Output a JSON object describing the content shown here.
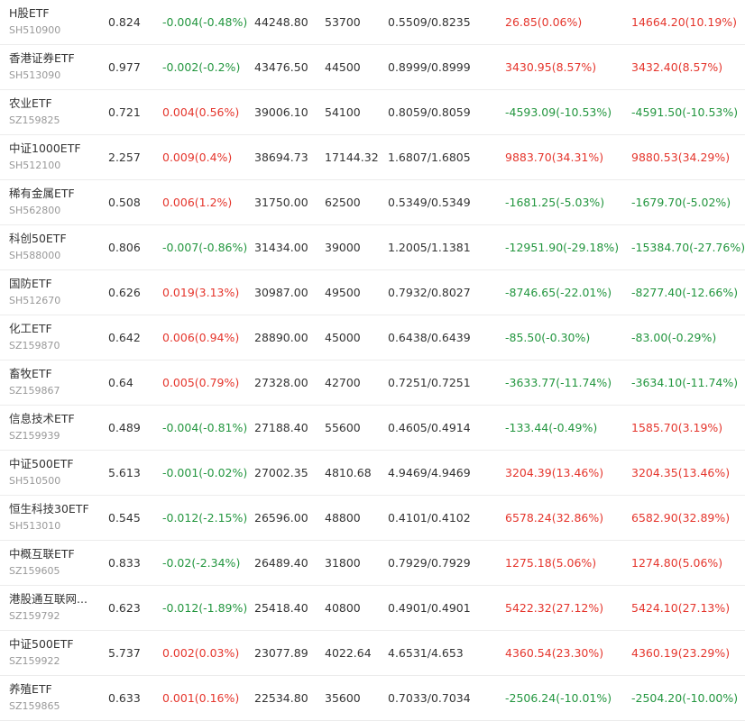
{
  "colors": {
    "up": "#e5362d",
    "down": "#23963f",
    "text": "#333333",
    "muted": "#999999"
  },
  "rows": [
    {
      "name": "H股ETF",
      "code": "SH510900",
      "price": "0.824",
      "change": "-0.004(-0.48%)",
      "change_dir": "down",
      "amount": "44248.80",
      "volume": "53700",
      "range": "0.5509/0.8235",
      "pnl1": "26.85(0.06%)",
      "pnl1_dir": "up",
      "pnl2": "14664.20(10.19%)",
      "pnl2_dir": "up"
    },
    {
      "name": "香港证券ETF",
      "code": "SH513090",
      "price": "0.977",
      "change": "-0.002(-0.2%)",
      "change_dir": "down",
      "amount": "43476.50",
      "volume": "44500",
      "range": "0.8999/0.8999",
      "pnl1": "3430.95(8.57%)",
      "pnl1_dir": "up",
      "pnl2": "3432.40(8.57%)",
      "pnl2_dir": "up"
    },
    {
      "name": "农业ETF",
      "code": "SZ159825",
      "price": "0.721",
      "change": "0.004(0.56%)",
      "change_dir": "up",
      "amount": "39006.10",
      "volume": "54100",
      "range": "0.8059/0.8059",
      "pnl1": "-4593.09(-10.53%)",
      "pnl1_dir": "down",
      "pnl2": "-4591.50(-10.53%)",
      "pnl2_dir": "down"
    },
    {
      "name": "中证1000ETF",
      "code": "SH512100",
      "price": "2.257",
      "change": "0.009(0.4%)",
      "change_dir": "up",
      "amount": "38694.73",
      "volume": "17144.32",
      "range": "1.6807/1.6805",
      "pnl1": "9883.70(34.31%)",
      "pnl1_dir": "up",
      "pnl2": "9880.53(34.29%)",
      "pnl2_dir": "up"
    },
    {
      "name": "稀有金属ETF",
      "code": "SH562800",
      "price": "0.508",
      "change": "0.006(1.2%)",
      "change_dir": "up",
      "amount": "31750.00",
      "volume": "62500",
      "range": "0.5349/0.5349",
      "pnl1": "-1681.25(-5.03%)",
      "pnl1_dir": "down",
      "pnl2": "-1679.70(-5.02%)",
      "pnl2_dir": "down"
    },
    {
      "name": "科创50ETF",
      "code": "SH588000",
      "price": "0.806",
      "change": "-0.007(-0.86%)",
      "change_dir": "down",
      "amount": "31434.00",
      "volume": "39000",
      "range": "1.2005/1.1381",
      "pnl1": "-12951.90(-29.18%)",
      "pnl1_dir": "down",
      "pnl2": "-15384.70(-27.76%)",
      "pnl2_dir": "down"
    },
    {
      "name": "国防ETF",
      "code": "SH512670",
      "price": "0.626",
      "change": "0.019(3.13%)",
      "change_dir": "up",
      "amount": "30987.00",
      "volume": "49500",
      "range": "0.7932/0.8027",
      "pnl1": "-8746.65(-22.01%)",
      "pnl1_dir": "down",
      "pnl2": "-8277.40(-12.66%)",
      "pnl2_dir": "down"
    },
    {
      "name": "化工ETF",
      "code": "SZ159870",
      "price": "0.642",
      "change": "0.006(0.94%)",
      "change_dir": "up",
      "amount": "28890.00",
      "volume": "45000",
      "range": "0.6438/0.6439",
      "pnl1": "-85.50(-0.30%)",
      "pnl1_dir": "down",
      "pnl2": "-83.00(-0.29%)",
      "pnl2_dir": "down"
    },
    {
      "name": "畜牧ETF",
      "code": "SZ159867",
      "price": "0.64",
      "change": "0.005(0.79%)",
      "change_dir": "up",
      "amount": "27328.00",
      "volume": "42700",
      "range": "0.7251/0.7251",
      "pnl1": "-3633.77(-11.74%)",
      "pnl1_dir": "down",
      "pnl2": "-3634.10(-11.74%)",
      "pnl2_dir": "down"
    },
    {
      "name": "信息技术ETF",
      "code": "SZ159939",
      "price": "0.489",
      "change": "-0.004(-0.81%)",
      "change_dir": "down",
      "amount": "27188.40",
      "volume": "55600",
      "range": "0.4605/0.4914",
      "pnl1": "-133.44(-0.49%)",
      "pnl1_dir": "down",
      "pnl2": "1585.70(3.19%)",
      "pnl2_dir": "up"
    },
    {
      "name": "中证500ETF",
      "code": "SH510500",
      "price": "5.613",
      "change": "-0.001(-0.02%)",
      "change_dir": "down",
      "amount": "27002.35",
      "volume": "4810.68",
      "range": "4.9469/4.9469",
      "pnl1": "3204.39(13.46%)",
      "pnl1_dir": "up",
      "pnl2": "3204.35(13.46%)",
      "pnl2_dir": "up"
    },
    {
      "name": "恒生科技30ETF",
      "code": "SH513010",
      "price": "0.545",
      "change": "-0.012(-2.15%)",
      "change_dir": "down",
      "amount": "26596.00",
      "volume": "48800",
      "range": "0.4101/0.4102",
      "pnl1": "6578.24(32.86%)",
      "pnl1_dir": "up",
      "pnl2": "6582.90(32.89%)",
      "pnl2_dir": "up"
    },
    {
      "name": "中概互联ETF",
      "code": "SZ159605",
      "price": "0.833",
      "change": "-0.02(-2.34%)",
      "change_dir": "down",
      "amount": "26489.40",
      "volume": "31800",
      "range": "0.7929/0.7929",
      "pnl1": "1275.18(5.06%)",
      "pnl1_dir": "up",
      "pnl2": "1274.80(5.06%)",
      "pnl2_dir": "up"
    },
    {
      "name": "港股通互联网...",
      "code": "SZ159792",
      "price": "0.623",
      "change": "-0.012(-1.89%)",
      "change_dir": "down",
      "amount": "25418.40",
      "volume": "40800",
      "range": "0.4901/0.4901",
      "pnl1": "5422.32(27.12%)",
      "pnl1_dir": "up",
      "pnl2": "5424.10(27.13%)",
      "pnl2_dir": "up"
    },
    {
      "name": "中证500ETF",
      "code": "SZ159922",
      "price": "5.737",
      "change": "0.002(0.03%)",
      "change_dir": "up",
      "amount": "23077.89",
      "volume": "4022.64",
      "range": "4.6531/4.653",
      "pnl1": "4360.54(23.30%)",
      "pnl1_dir": "up",
      "pnl2": "4360.19(23.29%)",
      "pnl2_dir": "up"
    },
    {
      "name": "养殖ETF",
      "code": "SZ159865",
      "price": "0.633",
      "change": "0.001(0.16%)",
      "change_dir": "up",
      "amount": "22534.80",
      "volume": "35600",
      "range": "0.7033/0.7034",
      "pnl1": "-2506.24(-10.01%)",
      "pnl1_dir": "down",
      "pnl2": "-2504.20(-10.00%)",
      "pnl2_dir": "down"
    }
  ]
}
